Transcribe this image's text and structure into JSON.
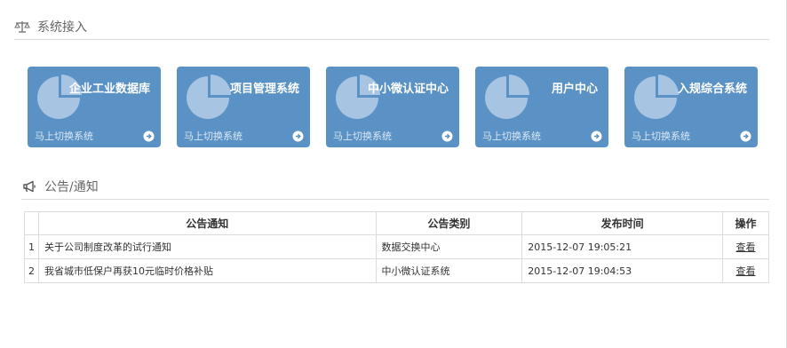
{
  "system_section": {
    "title": "系统接入",
    "icon": "scale-icon"
  },
  "tiles": [
    {
      "title": "企业工业数据库",
      "link": "马上切换系统",
      "icon": "pie-chart-icon"
    },
    {
      "title": "项目管理系统",
      "link": "马上切换系统",
      "icon": "pie-chart-icon"
    },
    {
      "title": "中小微认证中心",
      "link": "马上切换系统",
      "icon": "pie-chart-icon"
    },
    {
      "title": "用户中心",
      "link": "马上切换系统",
      "icon": "pie-chart-icon"
    },
    {
      "title": "入规综合系统",
      "link": "马上切换系统",
      "icon": "pie-chart-icon"
    }
  ],
  "notice_section": {
    "title": "公告/通知",
    "icon": "megaphone-icon"
  },
  "notice_table": {
    "headers": [
      "",
      "公告通知",
      "公告类别",
      "发布时间",
      "操作"
    ],
    "rows": [
      {
        "index": "1",
        "title": "关于公司制度改革的试行通知",
        "category": "数据交换中心",
        "time": "2015-12-07 19:05:21",
        "action": "查看"
      },
      {
        "index": "2",
        "title": "我省城市低保户再获10元临时价格补贴",
        "category": "中小微认证系统",
        "time": "2015-12-07 19:04:53",
        "action": "查看"
      }
    ]
  },
  "colors": {
    "tile_bg": "#5b92c5",
    "border": "#dcdcdc"
  }
}
